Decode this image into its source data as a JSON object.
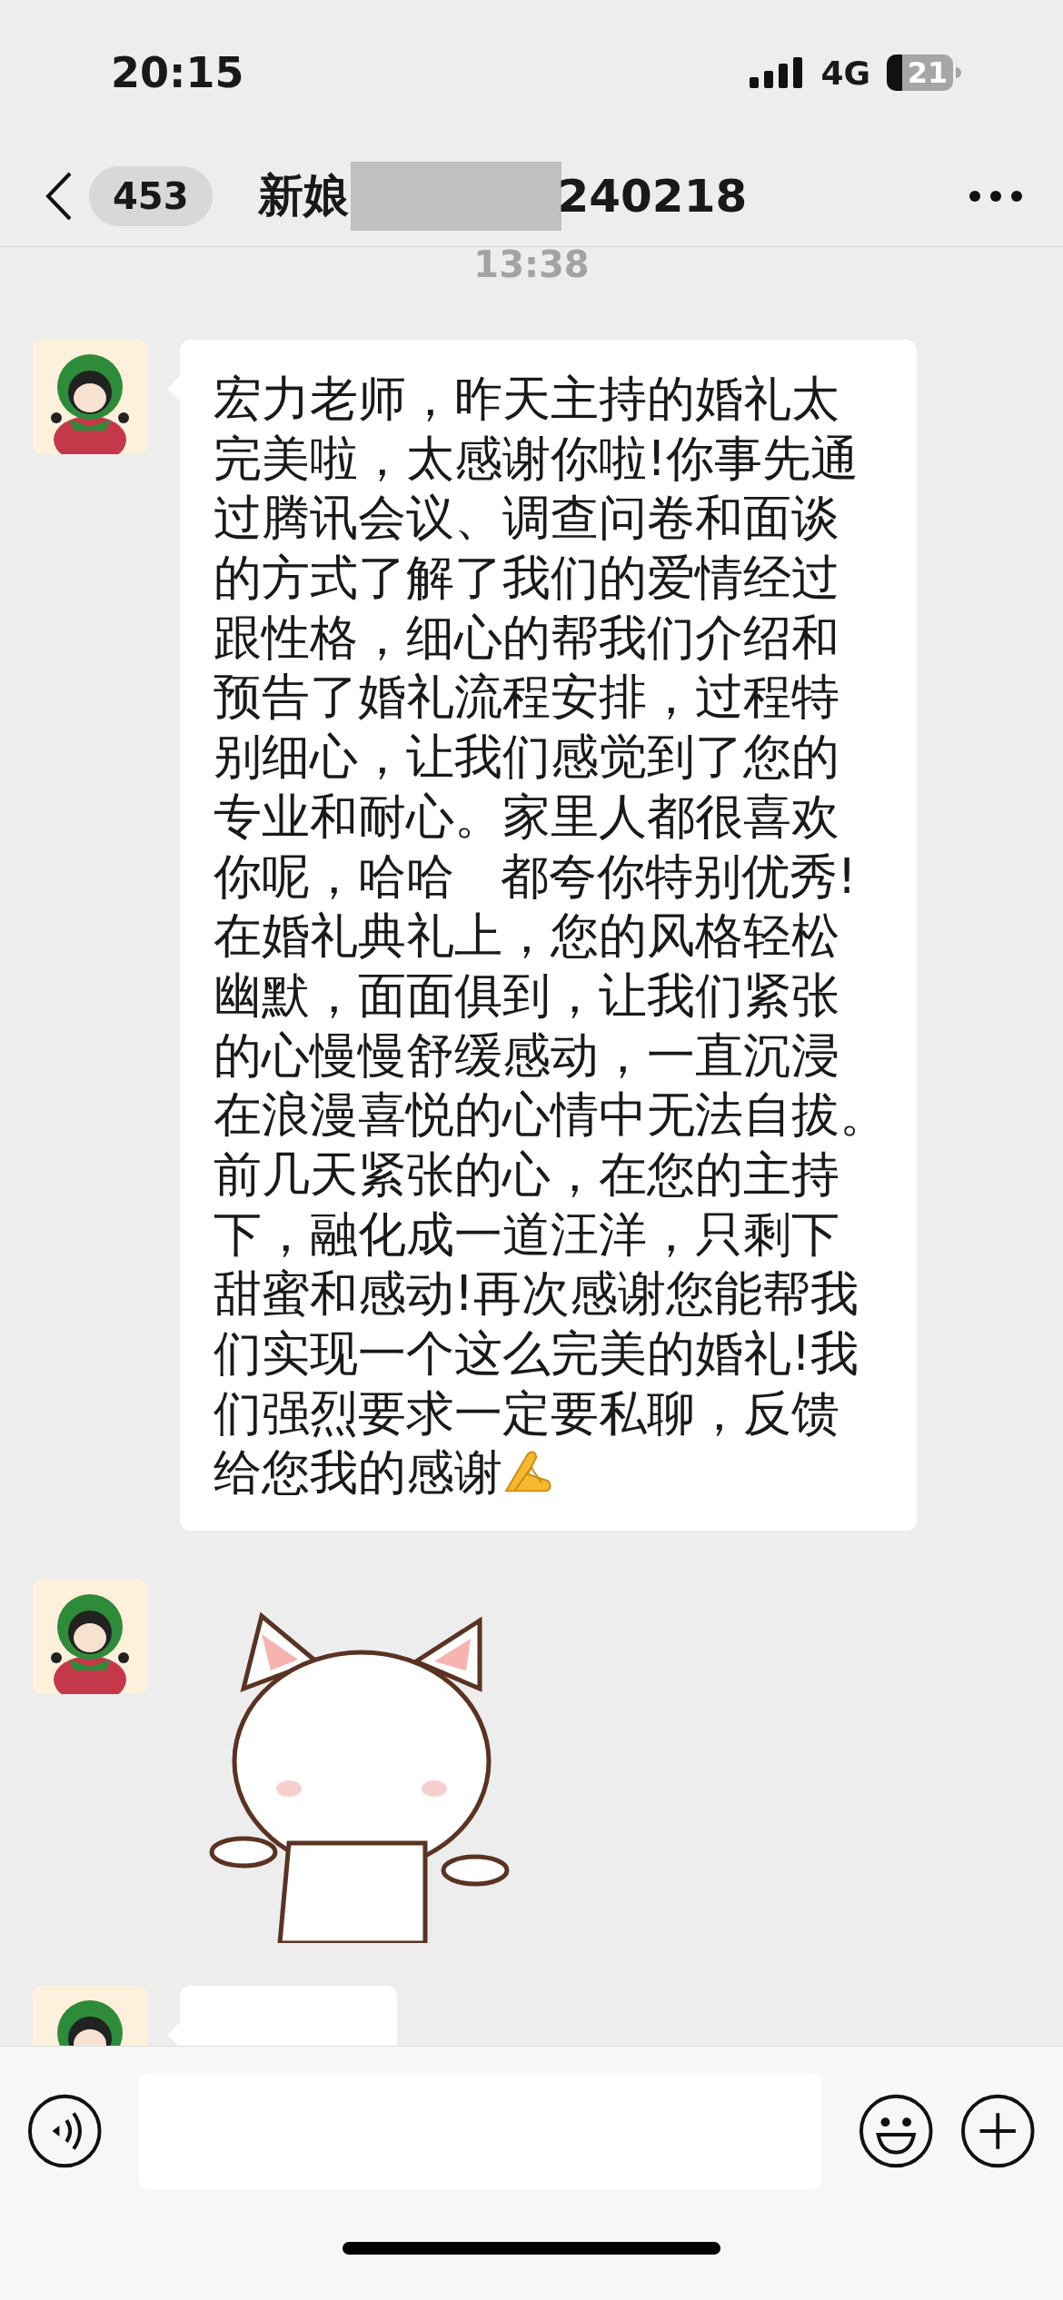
{
  "status_bar": {
    "time": "20:15",
    "network": "4G",
    "battery": "21"
  },
  "nav": {
    "back_count": "453",
    "title_start": "新娘",
    "title_end": "240218"
  },
  "chat": {
    "timestamp": "13:38",
    "messages": [
      {
        "kind": "text",
        "lines": [
          "宏力老师，昨天主持的婚礼太",
          "完美啦，太感谢你啦!你事先通",
          "过腾讯会议、调查问卷和面谈",
          "的方式了解了我们的爱情经过",
          "跟性格，细心的帮我们介绍和",
          "预告了婚礼流程安排，过程特",
          "别细心，让我们感觉到了您的",
          "专业和耐心。家里人都很喜欢",
          "你呢，哈哈   都夸你特别优秀!",
          "在婚礼典礼上，您的风格轻松",
          "幽默，面面俱到，让我们紧张",
          "的心慢慢舒缓感动，一直沉浸",
          "在浪漫喜悦的心情中无法自拔。",
          "前几天紧张的心，在您的主持",
          "下，融化成一道汪洋，只剩下",
          "甜蜜和感动!再次感谢您能帮我",
          "们实现一个这么完美的婚礼!我",
          "们强烈要求一定要私聊，反馈",
          "给您我的感谢"
        ],
        "hands_icon": true
      },
      {
        "kind": "sticker"
      },
      {
        "kind": "cut_bubble"
      }
    ]
  }
}
